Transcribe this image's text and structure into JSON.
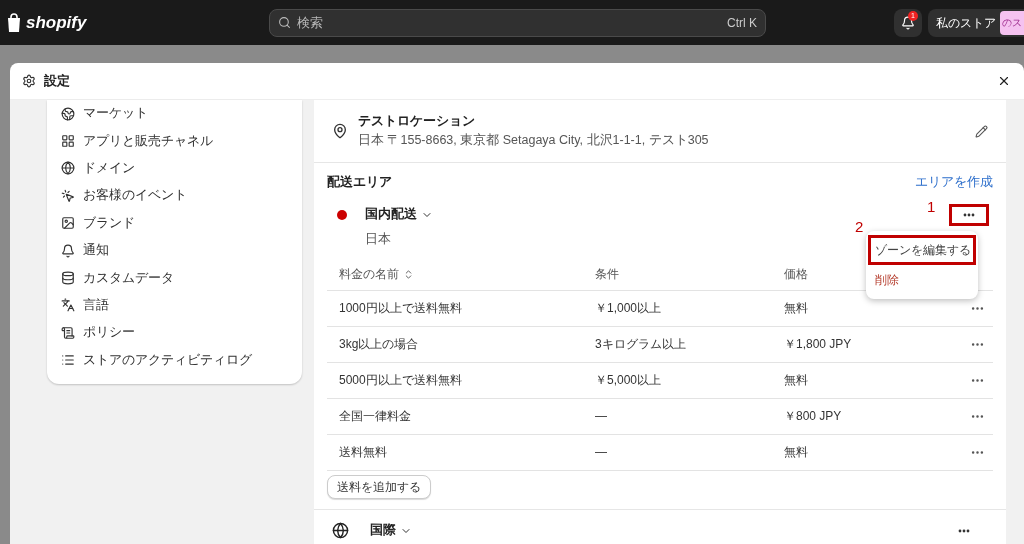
{
  "topbar": {
    "logo": "shopify",
    "search": {
      "placeholder": "検索",
      "shortcut": "Ctrl K"
    },
    "notification_count": "1",
    "store": {
      "label": "私のストア",
      "avatar": "のス"
    }
  },
  "modal": {
    "title": "設定"
  },
  "sidebar": {
    "items": [
      {
        "label": "マーケット"
      },
      {
        "label": "アプリと販売チャネル"
      },
      {
        "label": "ドメイン"
      },
      {
        "label": "お客様のイベント"
      },
      {
        "label": "ブランド"
      },
      {
        "label": "通知"
      },
      {
        "label": "カスタムデータ"
      },
      {
        "label": "言語"
      },
      {
        "label": "ポリシー"
      },
      {
        "label": "ストアのアクティビティログ"
      }
    ]
  },
  "location": {
    "name": "テストロケーション",
    "address": "日本 〒155-8663, 東京都 Setagaya City, 北沢1-1-1, テスト305"
  },
  "shipping": {
    "title": "配送エリア",
    "create_link": "エリアを作成",
    "zones": [
      {
        "name": "国内配送",
        "subtitle": "日本",
        "kind": "dot",
        "color": "#cc0000",
        "highlighted": true,
        "columns": [
          "料金の名前",
          "条件",
          "価格"
        ],
        "rows": [
          [
            "1000円以上で送料無料",
            "￥1,000以上",
            "無料"
          ],
          [
            "3kg以上の場合",
            "3キログラム以上",
            "￥1,800 JPY"
          ],
          [
            "5000円以上で送料無料",
            "￥5,000以上",
            "無料"
          ],
          [
            "全国一律料金",
            "—",
            "￥800 JPY"
          ],
          [
            "送料無料",
            "—",
            "無料"
          ]
        ],
        "add_button": "送料を追加する"
      },
      {
        "name": "国際",
        "kind": "globe",
        "highlighted": false
      }
    ]
  },
  "menu": {
    "items": [
      {
        "label": "ゾーンを編集する",
        "kind": "normal",
        "highlighted": true
      },
      {
        "label": "削除",
        "kind": "danger",
        "highlighted": false
      }
    ]
  },
  "annotations": [
    "1",
    "2"
  ]
}
